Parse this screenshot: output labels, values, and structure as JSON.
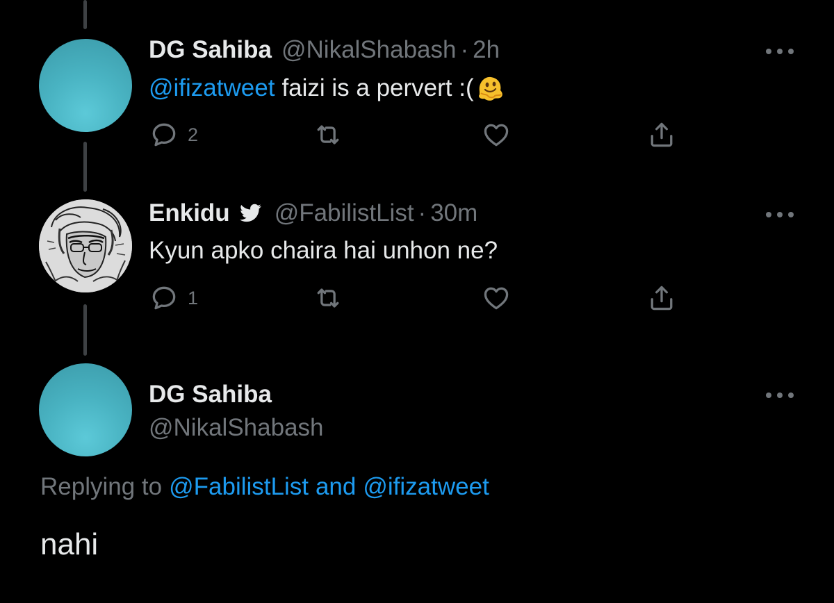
{
  "tweets": [
    {
      "display_name": "DG Sahiba",
      "handle": "@NikalShabash",
      "separator": "·",
      "time": "2h",
      "mention": "@ifizatweet",
      "text": "faizi is a pervert :(",
      "emoji": "melting-face",
      "reply_count": "2"
    },
    {
      "display_name": "Enkidu",
      "handle": "@FabilistList",
      "separator": "·",
      "time": "30m",
      "text": "Kyun apko chaira hai unhon ne?",
      "reply_count": "1"
    }
  ],
  "focused_tweet": {
    "display_name": "DG Sahiba",
    "handle": "@NikalShabash",
    "replying_prefix": "Replying to",
    "replying_user_1": "@FabilistList",
    "replying_and": "and",
    "replying_user_2": "@ifizatweet",
    "text": "nahi"
  },
  "colors": {
    "background": "#000000",
    "text": "#e7e9ea",
    "muted": "#71767b",
    "accent": "#1d9bf0",
    "thread_line": "#3e4144",
    "avatar_teal": "#4cb8c6"
  }
}
